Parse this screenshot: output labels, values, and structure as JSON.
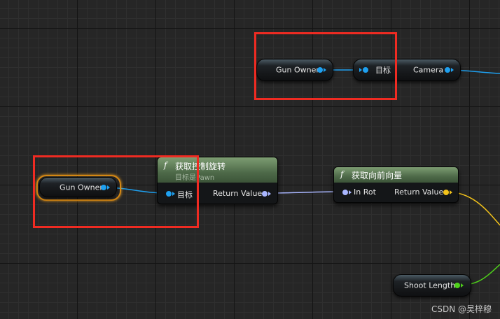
{
  "nodes": {
    "gun_owner_top": {
      "label": "Gun Owner"
    },
    "camera": {
      "target_label": "目标",
      "output_label": "Camera"
    },
    "gun_owner_selected": {
      "label": "Gun Owner"
    },
    "get_control_rotation": {
      "title": "获取控制旋转",
      "subtitle": "目标是Pawn",
      "input_label": "目标",
      "output_label": "Return Value"
    },
    "get_forward_vector": {
      "title": "获取向前向量",
      "input_label": "In Rot",
      "output_label": "Return Value"
    },
    "shoot_length": {
      "label": "Shoot Length"
    }
  },
  "function_symbol": "f",
  "colors": {
    "object_pin": "#1ea0f0",
    "rotator_pin": "#a9b6ff",
    "vector_pin": "#f3c31a",
    "float_pin": "#4ed01a",
    "highlight_box": "#ef2b22",
    "selection": "#d98a14"
  },
  "watermark": "CSDN @吴梓穆"
}
